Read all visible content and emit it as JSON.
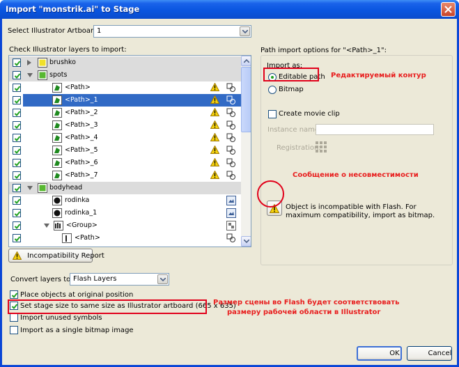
{
  "window": {
    "title": "Import \"monstrik.ai\" to Stage"
  },
  "artboard": {
    "label": "Select Illustrator Artboard:",
    "value": "1"
  },
  "layers_label": "Check Illustrator layers to import:",
  "layers": [
    {
      "name": "brushko",
      "kind": "layer",
      "expand": "collapsed",
      "checked": true,
      "icon_color": "#f0e02a"
    },
    {
      "name": "spots",
      "kind": "layer",
      "expand": "expanded",
      "checked": true,
      "icon_color": "#58b832"
    },
    {
      "name": "<Path>",
      "kind": "path",
      "checked": true,
      "warning": true,
      "type_icon": "shape"
    },
    {
      "name": "<Path>_1",
      "kind": "path",
      "checked": true,
      "warning": true,
      "type_icon": "shape",
      "selected": true
    },
    {
      "name": "<Path>_2",
      "kind": "path",
      "checked": true,
      "warning": true,
      "type_icon": "shape"
    },
    {
      "name": "<Path>_3",
      "kind": "path",
      "checked": true,
      "warning": true,
      "type_icon": "shape"
    },
    {
      "name": "<Path>_4",
      "kind": "path",
      "checked": true,
      "warning": true,
      "type_icon": "shape"
    },
    {
      "name": "<Path>_5",
      "kind": "path",
      "checked": true,
      "warning": true,
      "type_icon": "shape"
    },
    {
      "name": "<Path>_6",
      "kind": "path",
      "checked": true,
      "warning": true,
      "type_icon": "shape"
    },
    {
      "name": "<Path>_7",
      "kind": "path",
      "checked": true,
      "warning": true,
      "type_icon": "shape"
    },
    {
      "name": "bodyhead",
      "kind": "layer",
      "expand": "expanded",
      "checked": true,
      "icon_color": "#58b832"
    },
    {
      "name": "rodinka",
      "kind": "item",
      "checked": true,
      "type_icon": "bitmap"
    },
    {
      "name": "rodinka_1",
      "kind": "item",
      "checked": true,
      "type_icon": "bitmap"
    },
    {
      "name": "<Group>",
      "kind": "group",
      "expand": "expanded",
      "checked": true,
      "type_icon": "group"
    },
    {
      "name": "<Path>",
      "kind": "subpath",
      "checked": true,
      "type_icon": "shape"
    }
  ],
  "options": {
    "header": "Path import options for \"<Path>_1\":",
    "import_as_label": "Import as:",
    "editable_path": "Editable path",
    "bitmap": "Bitmap",
    "create_movie_clip": "Create movie clip",
    "instance_name_label": "Instance name:",
    "registration_label": "Registration:",
    "incompat_message": "Object is incompatible with Flash. For maximum compatibility, import as bitmap."
  },
  "incompat_button": "Incompatibility Report",
  "convert": {
    "label": "Convert layers to:",
    "value": "Flash Layers"
  },
  "checkboxes": [
    {
      "label": "Place objects at original position",
      "checked": true
    },
    {
      "label": "Set stage size to same size as Illustrator artboard (665 x 635)",
      "checked": true
    },
    {
      "label": "Import unused symbols",
      "checked": false
    },
    {
      "label": "Import as a single bitmap image",
      "checked": false
    }
  ],
  "buttons": {
    "ok": "OK",
    "cancel": "Cancel"
  },
  "annotations": {
    "editable": "Редактируемый контур",
    "incompat": "Сообщение о несовместимости",
    "stage_line1": "Размер сцены во Flash будет соответствовать",
    "stage_line2": "размеру рабочей области в Illustrator"
  },
  "colors": {
    "annotation": "#e81e1e",
    "selection": "#316ac5",
    "title_bar": "#0a55e0"
  }
}
